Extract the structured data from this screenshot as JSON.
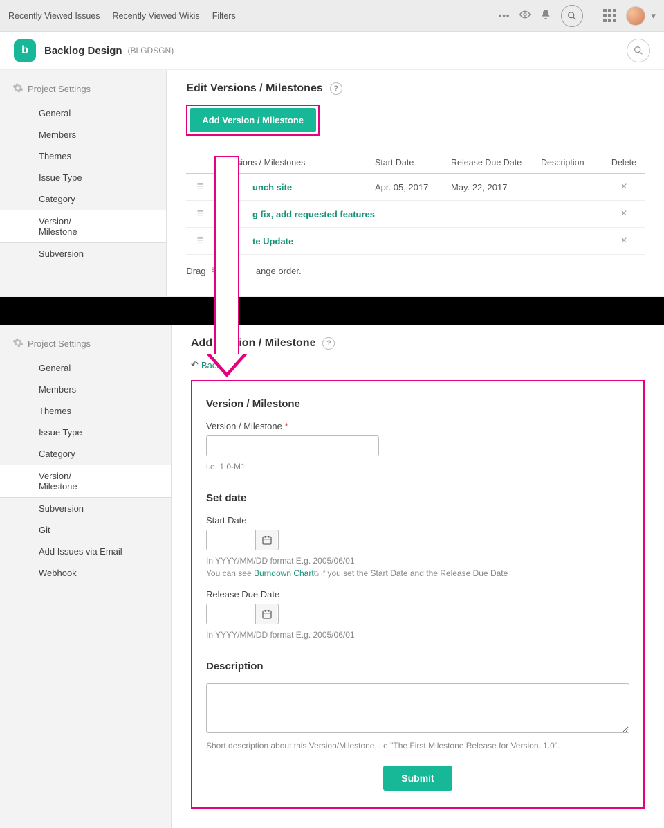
{
  "topbar": {
    "links": [
      "Recently Viewed Issues",
      "Recently Viewed Wikis",
      "Filters"
    ]
  },
  "project": {
    "logo_letter": "b",
    "name": "Backlog Design",
    "key": "(BLGDSGN)"
  },
  "sidebar": {
    "heading": "Project Settings",
    "items1": [
      "General",
      "Members",
      "Themes",
      "Issue Type",
      "Category",
      "Version/\nMilestone",
      "Subversion"
    ],
    "items2": [
      "General",
      "Members",
      "Themes",
      "Issue Type",
      "Category",
      "Version/\nMilestone",
      "Subversion",
      "Git",
      "Add Issues via Email",
      "Webhook"
    ]
  },
  "page1": {
    "title": "Edit Versions / Milestones",
    "add_btn": "Add Version / Milestone",
    "cols": {
      "name": "of Versions / Milestones",
      "start": "Start Date",
      "due": "Release Due Date",
      "desc": "Description",
      "del": "Delete"
    },
    "rows": [
      {
        "name": "Ver.         unch site",
        "start": "Apr. 05, 2017",
        "due": "May. 22, 2017"
      },
      {
        "name": "Ver.         g fix, add requested features",
        "start": "",
        "due": ""
      },
      {
        "name": "Ver.         te Update",
        "start": "",
        "due": ""
      }
    ],
    "drag_note_pre": "Drag",
    "drag_note_post": "to          ange order."
  },
  "page2": {
    "title": "Add Version / Milestone",
    "back": "Back",
    "section_vm": "Version / Milestone",
    "label_vm": "Version / Milestone",
    "hint_vm": "i.e. 1.0-M1",
    "section_date": "Set date",
    "label_start": "Start Date",
    "hint_date_fmt": "In YYYY/MM/DD format E.g. 2005/06/01",
    "hint_burndown_pre": "You can see ",
    "hint_burndown_link": "Burndown Chart",
    "hint_burndown_post": " if you set the Start Date and the Release Due Date",
    "label_due": "Release Due Date",
    "section_desc": "Description",
    "hint_desc": "Short description about this Version/Milestone, i.e \"The First Milestone Release for Version. 1.0\".",
    "submit": "Submit"
  }
}
